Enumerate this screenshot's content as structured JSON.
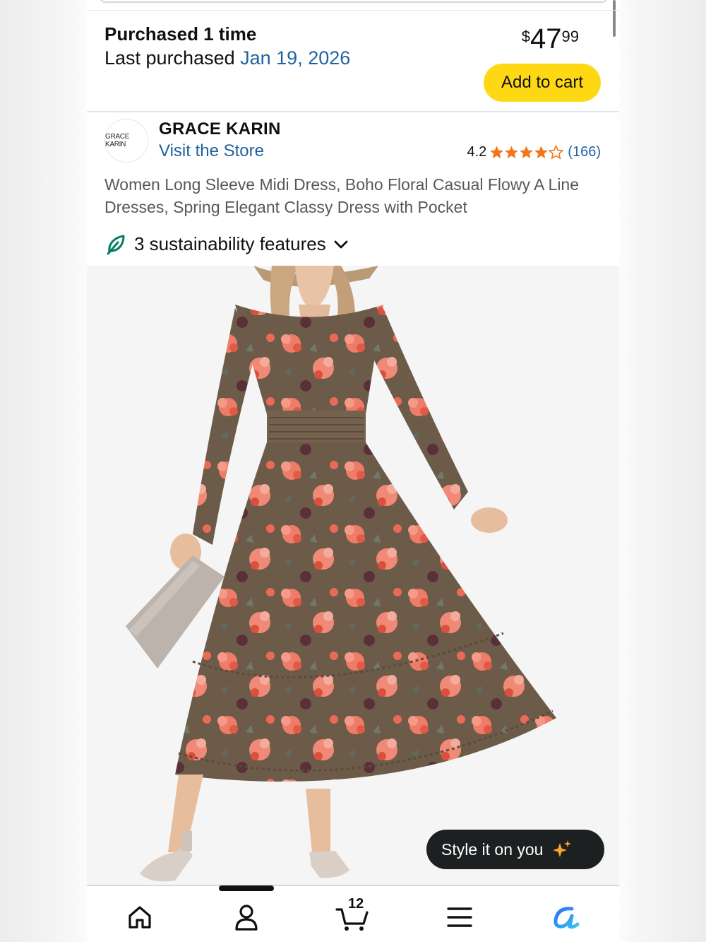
{
  "purchase": {
    "count_text": "Purchased 1 time",
    "last_label": "Last purchased ",
    "last_date": "Jan 19, 2026"
  },
  "price": {
    "symbol": "$",
    "whole": "47",
    "fraction": "99"
  },
  "add_to_cart_label": "Add to cart",
  "brand": {
    "logo_text": "GRACE KARIN",
    "name": "GRACE KARIN",
    "visit_store": "Visit the Store"
  },
  "rating": {
    "value": "4.2",
    "stars": 4.2,
    "count": "(166)"
  },
  "product_title": "Women Long Sleeve Midi Dress, Boho Floral Casual Flowy A Line Dresses, Spring Elegant Classy Dress with Pocket",
  "sustainability": {
    "label": "3 sustainability features"
  },
  "style_button": {
    "label": "Style it on you"
  },
  "nav": {
    "items": [
      "home-icon",
      "account-icon",
      "cart-icon",
      "menu-icon",
      "rufus-icon"
    ],
    "cart_count": "12"
  },
  "colors": {
    "link": "#2162a1",
    "cta": "#ffd814",
    "star": "#f3761b",
    "leaf": "#067d62"
  }
}
